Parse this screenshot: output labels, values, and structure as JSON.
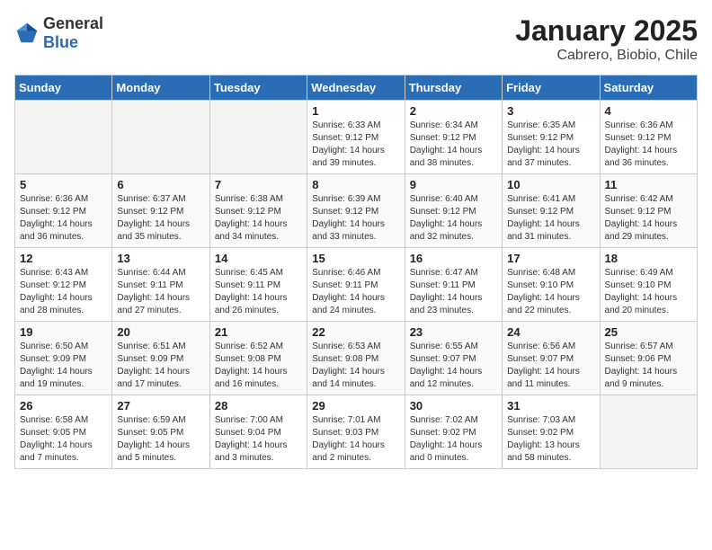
{
  "logo": {
    "general": "General",
    "blue": "Blue"
  },
  "header": {
    "month": "January 2025",
    "location": "Cabrero, Biobio, Chile"
  },
  "days_of_week": [
    "Sunday",
    "Monday",
    "Tuesday",
    "Wednesday",
    "Thursday",
    "Friday",
    "Saturday"
  ],
  "weeks": [
    [
      {
        "day": "",
        "sunrise": "",
        "sunset": "",
        "daylight": "",
        "empty": true
      },
      {
        "day": "",
        "sunrise": "",
        "sunset": "",
        "daylight": "",
        "empty": true
      },
      {
        "day": "",
        "sunrise": "",
        "sunset": "",
        "daylight": "",
        "empty": true
      },
      {
        "day": "1",
        "sunrise": "Sunrise: 6:33 AM",
        "sunset": "Sunset: 9:12 PM",
        "daylight": "Daylight: 14 hours and 39 minutes.",
        "empty": false
      },
      {
        "day": "2",
        "sunrise": "Sunrise: 6:34 AM",
        "sunset": "Sunset: 9:12 PM",
        "daylight": "Daylight: 14 hours and 38 minutes.",
        "empty": false
      },
      {
        "day": "3",
        "sunrise": "Sunrise: 6:35 AM",
        "sunset": "Sunset: 9:12 PM",
        "daylight": "Daylight: 14 hours and 37 minutes.",
        "empty": false
      },
      {
        "day": "4",
        "sunrise": "Sunrise: 6:36 AM",
        "sunset": "Sunset: 9:12 PM",
        "daylight": "Daylight: 14 hours and 36 minutes.",
        "empty": false
      }
    ],
    [
      {
        "day": "5",
        "sunrise": "Sunrise: 6:36 AM",
        "sunset": "Sunset: 9:12 PM",
        "daylight": "Daylight: 14 hours and 36 minutes.",
        "empty": false
      },
      {
        "day": "6",
        "sunrise": "Sunrise: 6:37 AM",
        "sunset": "Sunset: 9:12 PM",
        "daylight": "Daylight: 14 hours and 35 minutes.",
        "empty": false
      },
      {
        "day": "7",
        "sunrise": "Sunrise: 6:38 AM",
        "sunset": "Sunset: 9:12 PM",
        "daylight": "Daylight: 14 hours and 34 minutes.",
        "empty": false
      },
      {
        "day": "8",
        "sunrise": "Sunrise: 6:39 AM",
        "sunset": "Sunset: 9:12 PM",
        "daylight": "Daylight: 14 hours and 33 minutes.",
        "empty": false
      },
      {
        "day": "9",
        "sunrise": "Sunrise: 6:40 AM",
        "sunset": "Sunset: 9:12 PM",
        "daylight": "Daylight: 14 hours and 32 minutes.",
        "empty": false
      },
      {
        "day": "10",
        "sunrise": "Sunrise: 6:41 AM",
        "sunset": "Sunset: 9:12 PM",
        "daylight": "Daylight: 14 hours and 31 minutes.",
        "empty": false
      },
      {
        "day": "11",
        "sunrise": "Sunrise: 6:42 AM",
        "sunset": "Sunset: 9:12 PM",
        "daylight": "Daylight: 14 hours and 29 minutes.",
        "empty": false
      }
    ],
    [
      {
        "day": "12",
        "sunrise": "Sunrise: 6:43 AM",
        "sunset": "Sunset: 9:12 PM",
        "daylight": "Daylight: 14 hours and 28 minutes.",
        "empty": false
      },
      {
        "day": "13",
        "sunrise": "Sunrise: 6:44 AM",
        "sunset": "Sunset: 9:11 PM",
        "daylight": "Daylight: 14 hours and 27 minutes.",
        "empty": false
      },
      {
        "day": "14",
        "sunrise": "Sunrise: 6:45 AM",
        "sunset": "Sunset: 9:11 PM",
        "daylight": "Daylight: 14 hours and 26 minutes.",
        "empty": false
      },
      {
        "day": "15",
        "sunrise": "Sunrise: 6:46 AM",
        "sunset": "Sunset: 9:11 PM",
        "daylight": "Daylight: 14 hours and 24 minutes.",
        "empty": false
      },
      {
        "day": "16",
        "sunrise": "Sunrise: 6:47 AM",
        "sunset": "Sunset: 9:11 PM",
        "daylight": "Daylight: 14 hours and 23 minutes.",
        "empty": false
      },
      {
        "day": "17",
        "sunrise": "Sunrise: 6:48 AM",
        "sunset": "Sunset: 9:10 PM",
        "daylight": "Daylight: 14 hours and 22 minutes.",
        "empty": false
      },
      {
        "day": "18",
        "sunrise": "Sunrise: 6:49 AM",
        "sunset": "Sunset: 9:10 PM",
        "daylight": "Daylight: 14 hours and 20 minutes.",
        "empty": false
      }
    ],
    [
      {
        "day": "19",
        "sunrise": "Sunrise: 6:50 AM",
        "sunset": "Sunset: 9:09 PM",
        "daylight": "Daylight: 14 hours and 19 minutes.",
        "empty": false
      },
      {
        "day": "20",
        "sunrise": "Sunrise: 6:51 AM",
        "sunset": "Sunset: 9:09 PM",
        "daylight": "Daylight: 14 hours and 17 minutes.",
        "empty": false
      },
      {
        "day": "21",
        "sunrise": "Sunrise: 6:52 AM",
        "sunset": "Sunset: 9:08 PM",
        "daylight": "Daylight: 14 hours and 16 minutes.",
        "empty": false
      },
      {
        "day": "22",
        "sunrise": "Sunrise: 6:53 AM",
        "sunset": "Sunset: 9:08 PM",
        "daylight": "Daylight: 14 hours and 14 minutes.",
        "empty": false
      },
      {
        "day": "23",
        "sunrise": "Sunrise: 6:55 AM",
        "sunset": "Sunset: 9:07 PM",
        "daylight": "Daylight: 14 hours and 12 minutes.",
        "empty": false
      },
      {
        "day": "24",
        "sunrise": "Sunrise: 6:56 AM",
        "sunset": "Sunset: 9:07 PM",
        "daylight": "Daylight: 14 hours and 11 minutes.",
        "empty": false
      },
      {
        "day": "25",
        "sunrise": "Sunrise: 6:57 AM",
        "sunset": "Sunset: 9:06 PM",
        "daylight": "Daylight: 14 hours and 9 minutes.",
        "empty": false
      }
    ],
    [
      {
        "day": "26",
        "sunrise": "Sunrise: 6:58 AM",
        "sunset": "Sunset: 9:05 PM",
        "daylight": "Daylight: 14 hours and 7 minutes.",
        "empty": false
      },
      {
        "day": "27",
        "sunrise": "Sunrise: 6:59 AM",
        "sunset": "Sunset: 9:05 PM",
        "daylight": "Daylight: 14 hours and 5 minutes.",
        "empty": false
      },
      {
        "day": "28",
        "sunrise": "Sunrise: 7:00 AM",
        "sunset": "Sunset: 9:04 PM",
        "daylight": "Daylight: 14 hours and 3 minutes.",
        "empty": false
      },
      {
        "day": "29",
        "sunrise": "Sunrise: 7:01 AM",
        "sunset": "Sunset: 9:03 PM",
        "daylight": "Daylight: 14 hours and 2 minutes.",
        "empty": false
      },
      {
        "day": "30",
        "sunrise": "Sunrise: 7:02 AM",
        "sunset": "Sunset: 9:02 PM",
        "daylight": "Daylight: 14 hours and 0 minutes.",
        "empty": false
      },
      {
        "day": "31",
        "sunrise": "Sunrise: 7:03 AM",
        "sunset": "Sunset: 9:02 PM",
        "daylight": "Daylight: 13 hours and 58 minutes.",
        "empty": false
      },
      {
        "day": "",
        "sunrise": "",
        "sunset": "",
        "daylight": "",
        "empty": true
      }
    ]
  ]
}
